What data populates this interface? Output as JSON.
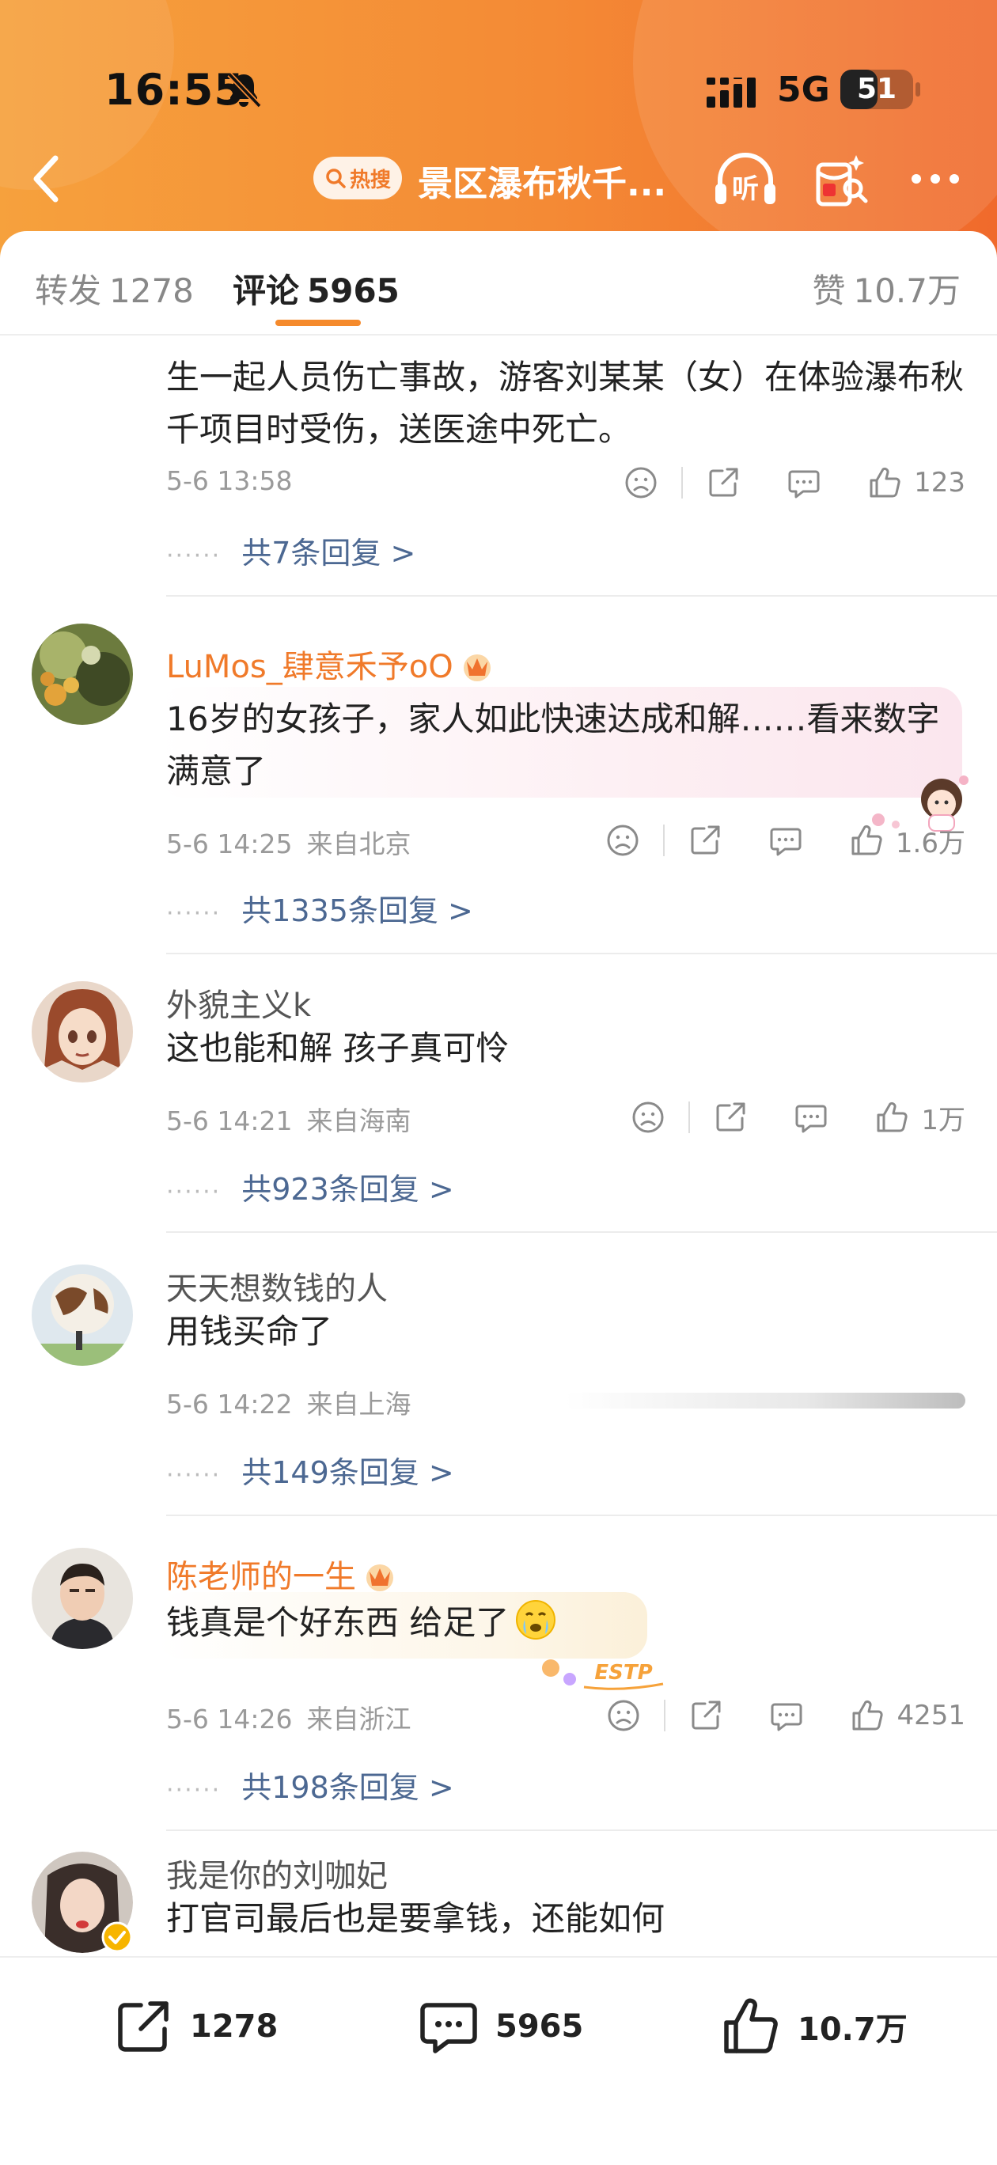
{
  "status_bar": {
    "time": "16:55",
    "network": "5G",
    "battery": "51",
    "battery_level": 0.51,
    "icons": [
      "bell-slash-icon",
      "signal-icon"
    ]
  },
  "nav": {
    "badge": "热搜",
    "title": "景区瀑布秋千...",
    "icons": [
      "back-arrow-icon",
      "headphones-listen-icon",
      "red-packet-icon",
      "more-icon"
    ],
    "listen_label": "听"
  },
  "tabs": [
    {
      "label": "转发",
      "count": "1278",
      "active": false
    },
    {
      "label": "评论",
      "count": "5965",
      "active": true
    },
    {
      "label": "赞",
      "count": "10.7万",
      "active": false
    }
  ],
  "comments": [
    {
      "username": "",
      "text": "生一起人员伤亡事故，游客刘某某（女）在体验瀑布秋千项目时受伤，送医途中死亡。",
      "time": "5-6 13:58",
      "location": "",
      "likes": "123",
      "replies": "共7条回复 >"
    },
    {
      "username": "LuMos_肆意禾予oO",
      "text": "16岁的女孩子，家人如此快速达成和解……看来数字满意了",
      "time": "5-6 14:25",
      "location": "来自北京",
      "likes": "1.6万",
      "replies": "共1335条回复 >"
    },
    {
      "username": "外貌主义k",
      "text": "这也能和解 孩子真可怜",
      "time": "5-6 14:21",
      "location": "来自海南",
      "likes": "1万",
      "replies": "共923条回复 >"
    },
    {
      "username": "天天想数钱的人",
      "text": "用钱买命了",
      "time": "5-6 14:22",
      "location": "来自上海",
      "likes": "",
      "replies": "共149条回复 >"
    },
    {
      "username": "陈老师的一生",
      "text": "钱真是个好东西 给足了",
      "time": "5-6 14:26",
      "location": "来自浙江",
      "likes": "4251",
      "replies": "共198条回复 >",
      "bubble_tag": "ESTP"
    },
    {
      "username": "我是你的刘咖妃",
      "text": "打官司最后也是要拿钱，还能如何"
    }
  ],
  "bottom_bar": {
    "reposts": "1278",
    "comments": "5965",
    "likes": "10.7万"
  },
  "colors": {
    "accent": "#f58a2c",
    "vip_name": "#f07a2a",
    "reply_link": "#4c6892",
    "header_start": "#f6a13d",
    "header_end": "#f06a2c"
  }
}
